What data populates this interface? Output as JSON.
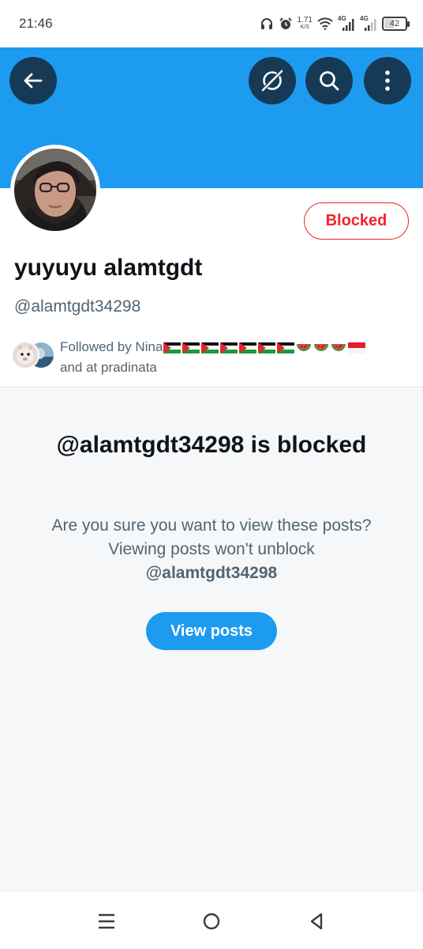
{
  "status_bar": {
    "time": "21:46",
    "speed_value": "1.71",
    "speed_unit": "K/S",
    "network_1": "4G",
    "network_2": "4G",
    "battery": "42",
    "battery_level_percent": 42,
    "icons": [
      "headphones-icon",
      "alarm-icon",
      "wifi-icon",
      "signal-icon",
      "signal-icon",
      "battery-icon"
    ]
  },
  "header": {
    "banner_color": "#1d9bf0",
    "buttons": [
      "back-arrow-icon",
      "grok-icon",
      "search-icon",
      "more-vertical-icon"
    ]
  },
  "profile": {
    "display_name": "yuyuyu alamtgdt",
    "handle": "@alamtgdt34298",
    "blocked_button_label": "Blocked",
    "followed_by_text": "Followed by Nina",
    "followed_by_emoji": [
      "palestine-flag",
      "palestine-flag",
      "palestine-flag",
      "palestine-flag",
      "palestine-flag",
      "palestine-flag",
      "palestine-flag",
      "watermelon",
      "watermelon",
      "watermelon",
      "indonesia-flag"
    ],
    "followed_by_rest": "and at pradinata"
  },
  "blocked_notice": {
    "title": "@alamtgdt34298 is blocked",
    "description": "Are you sure you want to view these posts? Viewing posts won't unblock",
    "description_handle": "@alamtgdt34298",
    "button_label": "View posts"
  },
  "nav_bar": {
    "buttons": [
      "menu-icon",
      "home-circle-icon",
      "back-triangle-icon"
    ]
  },
  "colors": {
    "accent": "#1d9bf0",
    "blocked_red": "#f4212e",
    "dark_button": "#163a55",
    "secondary_text": "#536471"
  }
}
